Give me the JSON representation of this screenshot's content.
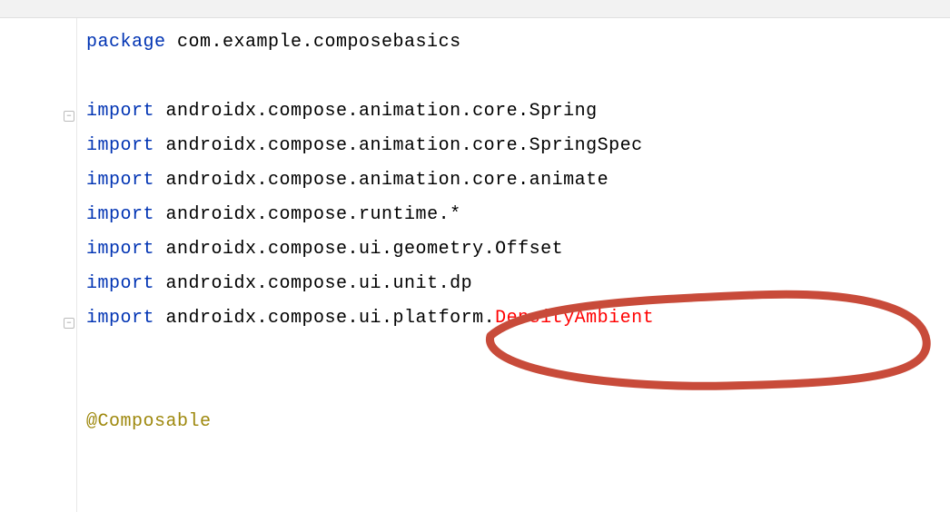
{
  "code": {
    "line1": {
      "keyword": "package",
      "rest": " com.example.composebasics"
    },
    "line3": {
      "keyword": "import",
      "rest": " androidx.compose.animation.core.Spring"
    },
    "line4": {
      "keyword": "import",
      "rest": " androidx.compose.animation.core.SpringSpec"
    },
    "line5": {
      "keyword": "import",
      "rest": " androidx.compose.animation.core.animate"
    },
    "line6": {
      "keyword": "import",
      "rest": " androidx.compose.runtime.*"
    },
    "line7": {
      "keyword": "import",
      "rest": " androidx.compose.ui.geometry.Offset"
    },
    "line8": {
      "keyword": "import",
      "rest": " androidx.compose.ui.unit.dp"
    },
    "line9": {
      "keyword": "import",
      "rest": " androidx.compose.ui.platform.",
      "error": "DensityAmbient"
    },
    "line12": {
      "annotation": "@Composable"
    }
  }
}
